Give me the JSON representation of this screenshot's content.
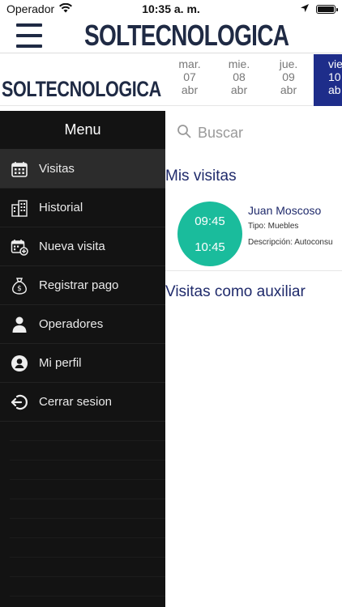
{
  "status_bar": {
    "carrier": "Operador",
    "time": "10:35 a. m."
  },
  "app": {
    "brand": "SOLTECNOLOGICA"
  },
  "date_strip": {
    "days": [
      {
        "dow": "mar.",
        "day": "07",
        "month": "abr"
      },
      {
        "dow": "mie.",
        "day": "08",
        "month": "abr"
      },
      {
        "dow": "jue.",
        "day": "09",
        "month": "abr"
      },
      {
        "dow": "vie",
        "day": "10",
        "month": "ab"
      }
    ],
    "selected_index": 3,
    "selected_color": "#1e2d8a"
  },
  "search": {
    "placeholder": "Buscar"
  },
  "sections": {
    "my_visits": "Mis visitas",
    "assistant_visits": "Visitas como auxiliar"
  },
  "visit": {
    "start": "09:45",
    "end": "10:45",
    "name": "Juan Moscoso",
    "type": "Tipo: Muebles",
    "description": "Descripción: Autoconsu",
    "circle_color": "#1abc9c"
  },
  "drawer": {
    "title": "Menu",
    "items": [
      {
        "label": "Visitas",
        "icon": "calendar-icon",
        "active": true
      },
      {
        "label": "Historial",
        "icon": "buildings-icon",
        "active": false
      },
      {
        "label": "Nueva visita",
        "icon": "calendar-add-icon",
        "active": false
      },
      {
        "label": "Registrar pago",
        "icon": "money-bag-icon",
        "active": false
      },
      {
        "label": "Operadores",
        "icon": "person-icon",
        "active": false
      },
      {
        "label": "Mi perfil",
        "icon": "profile-circle-icon",
        "active": false
      },
      {
        "label": "Cerrar sesion",
        "icon": "logout-icon",
        "active": false
      }
    ]
  }
}
